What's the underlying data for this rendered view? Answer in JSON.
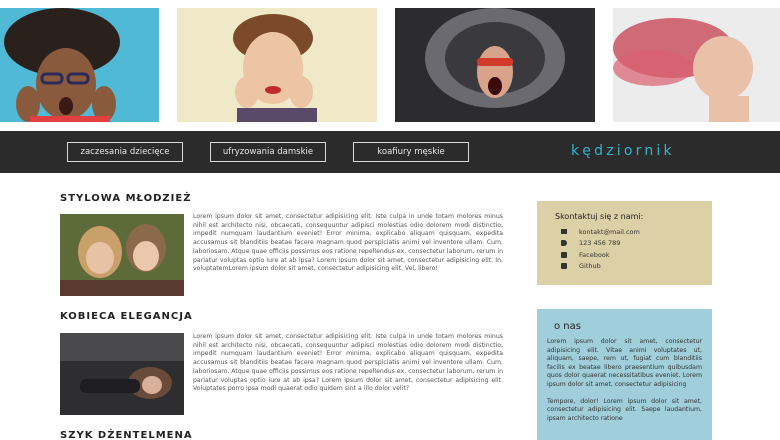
{
  "nav": {
    "buttons": [
      "zaczesania dziecięce",
      "ufryzowania damskie",
      "koafiury męskie"
    ],
    "brand": "kędziornik"
  },
  "hero": {
    "photos": [
      {
        "name": "hero-photo-curly-man"
      },
      {
        "name": "hero-photo-retro-woman"
      },
      {
        "name": "hero-photo-shouting-man"
      },
      {
        "name": "hero-photo-red-hair-woman"
      }
    ]
  },
  "sections": [
    {
      "title": "STYLOWA MŁODZIEŻ",
      "text": "Lorem ipsum dolor sit amet, consectetur adipisicing elit. Iste culpa in unde totam molores minus nihil est architecto nisi, obcaecati, consequuntur adipisci molestias odio dolorem modi distinctio, impedit numquam laudantium eveniet! Error minima, explicabo aliquam quisquam, expedita accusamus sit blanditiis beatae facere magnam quod perspiciatis animi vel inventore ullam. Cum, laboriosam. Atque quae officiis possimus eos ratione repellendus ex, consectetur laborum, rerum in pariatur voluptas optio iure at ab ipsa? Lorem ipsum dolor sit amet, consectetur adipisicing elit. In, voluptatemLorem ipsum dolor sit amet, consectetur adipisicing elit. Vel, libero!"
    },
    {
      "title": "KOBIECA ELEGANCJA",
      "text": "Lorem ipsum dolor sit amet, consectetur adipisicing elit. Iste culpa in unde totam molores minus nihil est architecto nisi, obcaecati, consequuntur adipisci molestias odio dolorem modi distinctio, impedit numquam laudantium eveniet! Error minima, explicabo aliquam quisquam, expedita accusamus sit blanditiis beatae facere magnam quod perspiciatis animi vel inventore ullam. Cum, laboriosam. Atque quae officiis possimus eos ratione repellendus ex, consectetur laborum, rerum in pariatur voluptas optio iure at ab ipsa? Lorem ipsum dolor sit amet, consectetur adipisicing elit. Voluptates porro ipsa modi quaerat odio quidem sint a illo dolor velit?"
    },
    {
      "title": "SZYK DŻENTELMENA"
    }
  ],
  "contact": {
    "title": "Skontaktuj się z nami:",
    "items": [
      {
        "icon": "envelope-icon",
        "text": "kontakt@mail.com"
      },
      {
        "icon": "phone-icon",
        "text": "123 456 789"
      },
      {
        "icon": "facebook-icon",
        "text": "Facebook"
      },
      {
        "icon": "github-icon",
        "text": "Github"
      }
    ]
  },
  "about": {
    "title": "o nas",
    "paragraphs": [
      "Lorem ipsum dolor sit amet, consectetur adipisicing elit. Vitae animi voluptates ut, aliquam, saepe, rem ut, fugiat cum blanditiis facilis ex beatae libero praesentium quibusdam quos dolor quaerat necessitatibus eveniet. Lorem ipsum dolor sit amet, consectetur adipisicing",
      "Tempore, dolor! Lorem ipsum dolor sit amet, consectetur adipisicing elit. Saepe laudantium, ipsam architecto ratione"
    ]
  },
  "colors": {
    "navbar": "#2b2b2b",
    "brand": "#2fb5cf",
    "contact_bg": "#dcd0a6",
    "about_bg": "#a0cfdb"
  }
}
